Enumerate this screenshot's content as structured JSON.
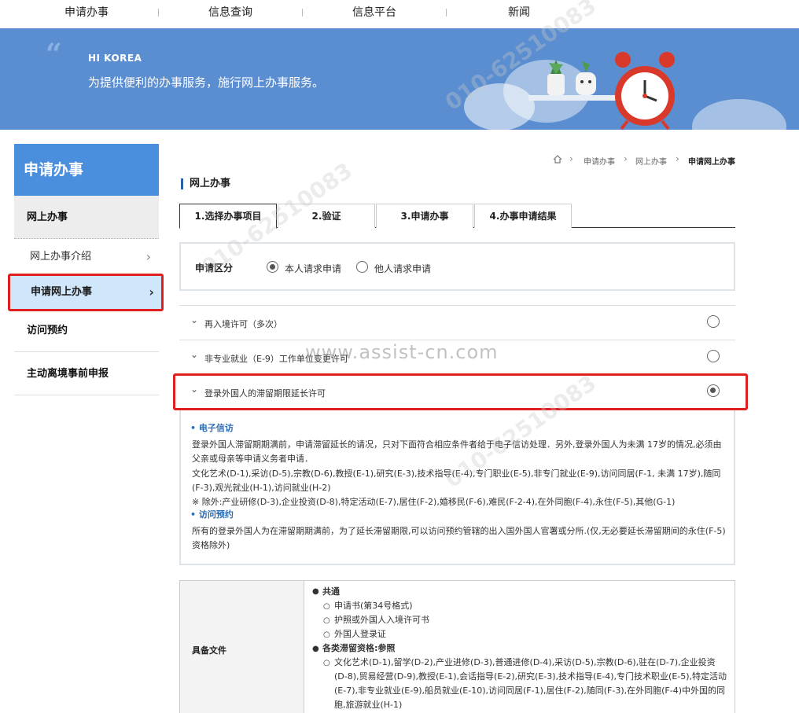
{
  "topnav": {
    "items": [
      "申请办事",
      "信息查询",
      "信息平台",
      "新闻"
    ]
  },
  "banner": {
    "brand": "HI KOREA",
    "slogan": "为提供便利的办事服务，施行网上办事服务。"
  },
  "sidebar": {
    "title": "申请办事",
    "section": "网上办事",
    "links": [
      {
        "label": "网上办事介绍"
      },
      {
        "label": "申请网上办事"
      }
    ],
    "main_items": [
      "访问预约",
      "主动离境事前申报"
    ]
  },
  "breadcrumb": {
    "items": [
      "申请办事",
      "网上办事",
      "申请网上办事"
    ]
  },
  "section_title": "网上办事",
  "tabs": [
    "1.选择办事项目",
    "2.验证",
    "3.申请办事",
    "4.办事申请结果"
  ],
  "applicant": {
    "label": "申请区分",
    "options": [
      "本人请求申请",
      "他人请求申请"
    ],
    "selected": "本人请求申请"
  },
  "permits": [
    {
      "label": "再入境许可（多次）",
      "selected": false
    },
    {
      "label": "非专业就业（E-9）工作单位变更许可",
      "selected": false
    },
    {
      "label": "登录外国人的滞留期限延长许可",
      "selected": true
    }
  ],
  "info": {
    "h1": "电子信访",
    "p1": "登录外国人滞留期期满前，申请滞留延长的请况，只对下面符合相应条件者给于电子信访处理．另外,登录外国人为未满 17岁的情况,必须由父亲或母亲等申请义务者申请．",
    "p2": "文化艺术(D-1),采访(D-5),宗教(D-6),教授(E-1),研究(E-3),技术指导(E-4),专门职业(E-5),非专门就业(E-9),访问同居(F-1, 未满 17岁),随同(F-3),观光就业(H-1),访问就业(H-2)",
    "p3": "※ 除外:产业研修(D-3),企业投资(D-8),特定活动(E-7),居住(F-2),婚移民(F-6),难民(F-2-4),在外同胞(F-4),永住(F-5),其他(G-1)",
    "h2": "访问预约",
    "p4": "所有的登录外国人为在滞留期期满前，为了延长滞留期限,可以访问预约管辖的出入国外国人官署或分所.(仅,无必要延长滞留期间的永住(F-5)资格除外)"
  },
  "docs": {
    "header": "具备文件",
    "common_title": "共通",
    "common_items": [
      "申请书(第34号格式)",
      "护照或外国人入境许可书",
      "外国人登录证"
    ],
    "status_title": "各类滞留资格:参照",
    "status_text": "文化艺术(D-1),留学(D-2),产业进修(D-3),普通进修(D-4),采访(D-5),宗教(D-6),驻在(D-7),企业投资(D-8),贸易经营(D-9),教授(E-1),会话指导(E-2),研究(E-3),技术指导(E-4),专门技术职业(E-5),特定活动(E-7),非专业就业(E-9),船员就业(E-10),访问同居(F-1),居住(F-2),随同(F-3),在外同胞(F-4)中外国的同胞,旅游就业(H-1)"
  },
  "watermarks": {
    "main": "www.assist-cn.com",
    "phone": "010-62510083"
  },
  "colors": {
    "banner": "#5a8ed0",
    "sidebar_title": "#4a8fde",
    "active_link": "#cfe6fb",
    "highlight": "#e02020",
    "info_heading": "#2b6cb8"
  }
}
